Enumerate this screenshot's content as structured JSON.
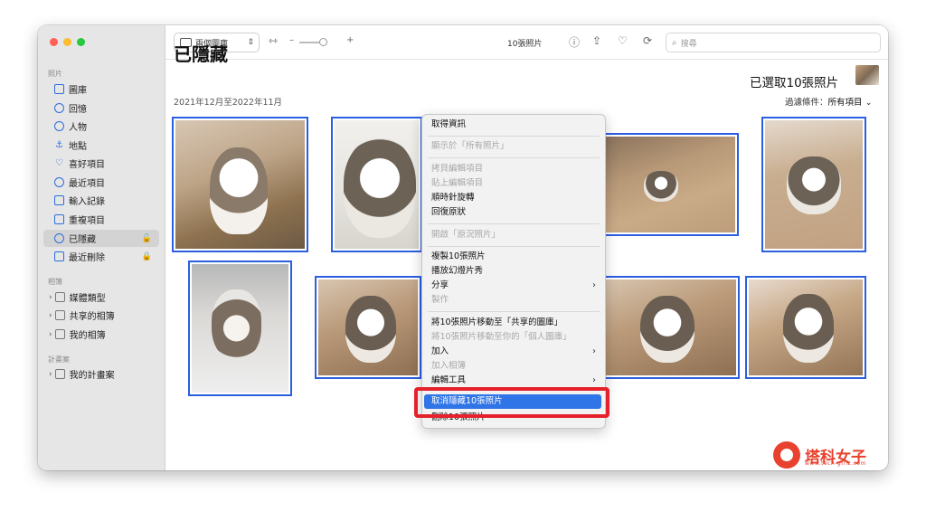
{
  "sidebar": {
    "section_photos": "照片",
    "items": [
      {
        "label": "圖庫",
        "icon": "library-icon"
      },
      {
        "label": "回憶",
        "icon": "memories-icon"
      },
      {
        "label": "人物",
        "icon": "people-icon"
      },
      {
        "label": "地點",
        "icon": "places-icon"
      },
      {
        "label": "喜好項目",
        "icon": "heart-icon"
      },
      {
        "label": "最近項目",
        "icon": "clock-icon"
      },
      {
        "label": "輸入記錄",
        "icon": "import-icon"
      },
      {
        "label": "重複項目",
        "icon": "duplicates-icon"
      },
      {
        "label": "已隱藏",
        "icon": "eye-slash-icon"
      },
      {
        "label": "最近刪除",
        "icon": "trash-icon"
      }
    ],
    "section_albums": "相簿",
    "albums": [
      {
        "label": "媒體類型"
      },
      {
        "label": "共享的相簿"
      },
      {
        "label": "我的相簿"
      }
    ],
    "section_projects": "計畫案",
    "projects": [
      {
        "label": "我的計畫案"
      }
    ]
  },
  "toolbar": {
    "view_select": "兩個圖庫",
    "photo_count": "10張照片",
    "search_placeholder": "搜尋"
  },
  "main": {
    "title": "已隱藏",
    "date_range": "2021年12月至2022年11月",
    "selected_count": "已選取10張照片",
    "filter_label": "過濾條件：",
    "filter_value": "所有項目"
  },
  "context_menu": {
    "items": [
      {
        "label": "取得資訊",
        "enabled": true
      },
      {
        "label": "顯示於「所有照片」",
        "enabled": false
      },
      {
        "label": "拷貝編輯項目",
        "enabled": false
      },
      {
        "label": "貼上編輯項目",
        "enabled": false
      },
      {
        "label": "順時針旋轉",
        "enabled": true
      },
      {
        "label": "回復原狀",
        "enabled": true
      },
      {
        "label": "開啟「原況照片」",
        "enabled": false
      },
      {
        "label": "複製10張照片",
        "enabled": true
      },
      {
        "label": "播放幻燈片秀",
        "enabled": true
      },
      {
        "label": "分享",
        "enabled": true
      },
      {
        "label": "製作",
        "enabled": false
      },
      {
        "label": "將10張照片移動至「共享的圖庫」",
        "enabled": true
      },
      {
        "label": "將10張照片移動至你的「個人圖庫」",
        "enabled": false
      },
      {
        "label": "加入",
        "enabled": true
      },
      {
        "label": "加入相簿",
        "enabled": false
      },
      {
        "label": "編輯工具",
        "enabled": true
      },
      {
        "label": "取消隱藏10張照片",
        "enabled": true,
        "highlighted": true
      },
      {
        "label": "刪除10張照片",
        "enabled": true
      }
    ]
  },
  "watermark": {
    "name": "塔科女子",
    "url": "www.tech-girlz.com"
  },
  "colors": {
    "selection_border": "#2b5fe0",
    "menu_highlight": "#2f75e8",
    "annotation_red": "#e5212b"
  }
}
